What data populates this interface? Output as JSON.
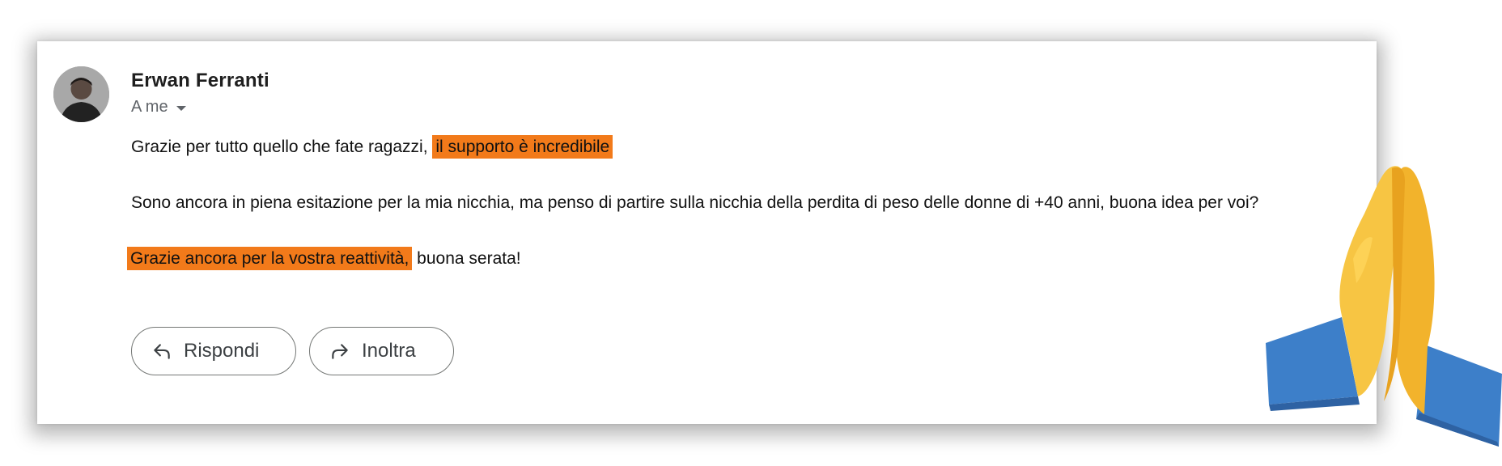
{
  "email": {
    "sender_name": "Erwan Ferranti",
    "recipient_label": "A me",
    "body": {
      "line1_plain": "Grazie per tutto quello che fate ragazzi,",
      "line1_highlight": "il supporto è incredibile",
      "paragraph2": "Sono ancora in piena esitazione per la mia nicchia, ma penso di partire sulla nicchia della perdita di peso delle donne di +40 anni, buona idea per voi?",
      "line4_highlight": "Grazie ancora per la vostra reattività,",
      "line4_plain": "buona serata!"
    },
    "highlight_color": "#f27a1a"
  },
  "actions": {
    "reply_label": "Rispondi",
    "reply_icon": "reply-arrow-icon",
    "forward_label": "Inoltra",
    "forward_icon": "forward-arrow-icon"
  },
  "decoration": {
    "emoji": "folded-hands-emoji"
  }
}
